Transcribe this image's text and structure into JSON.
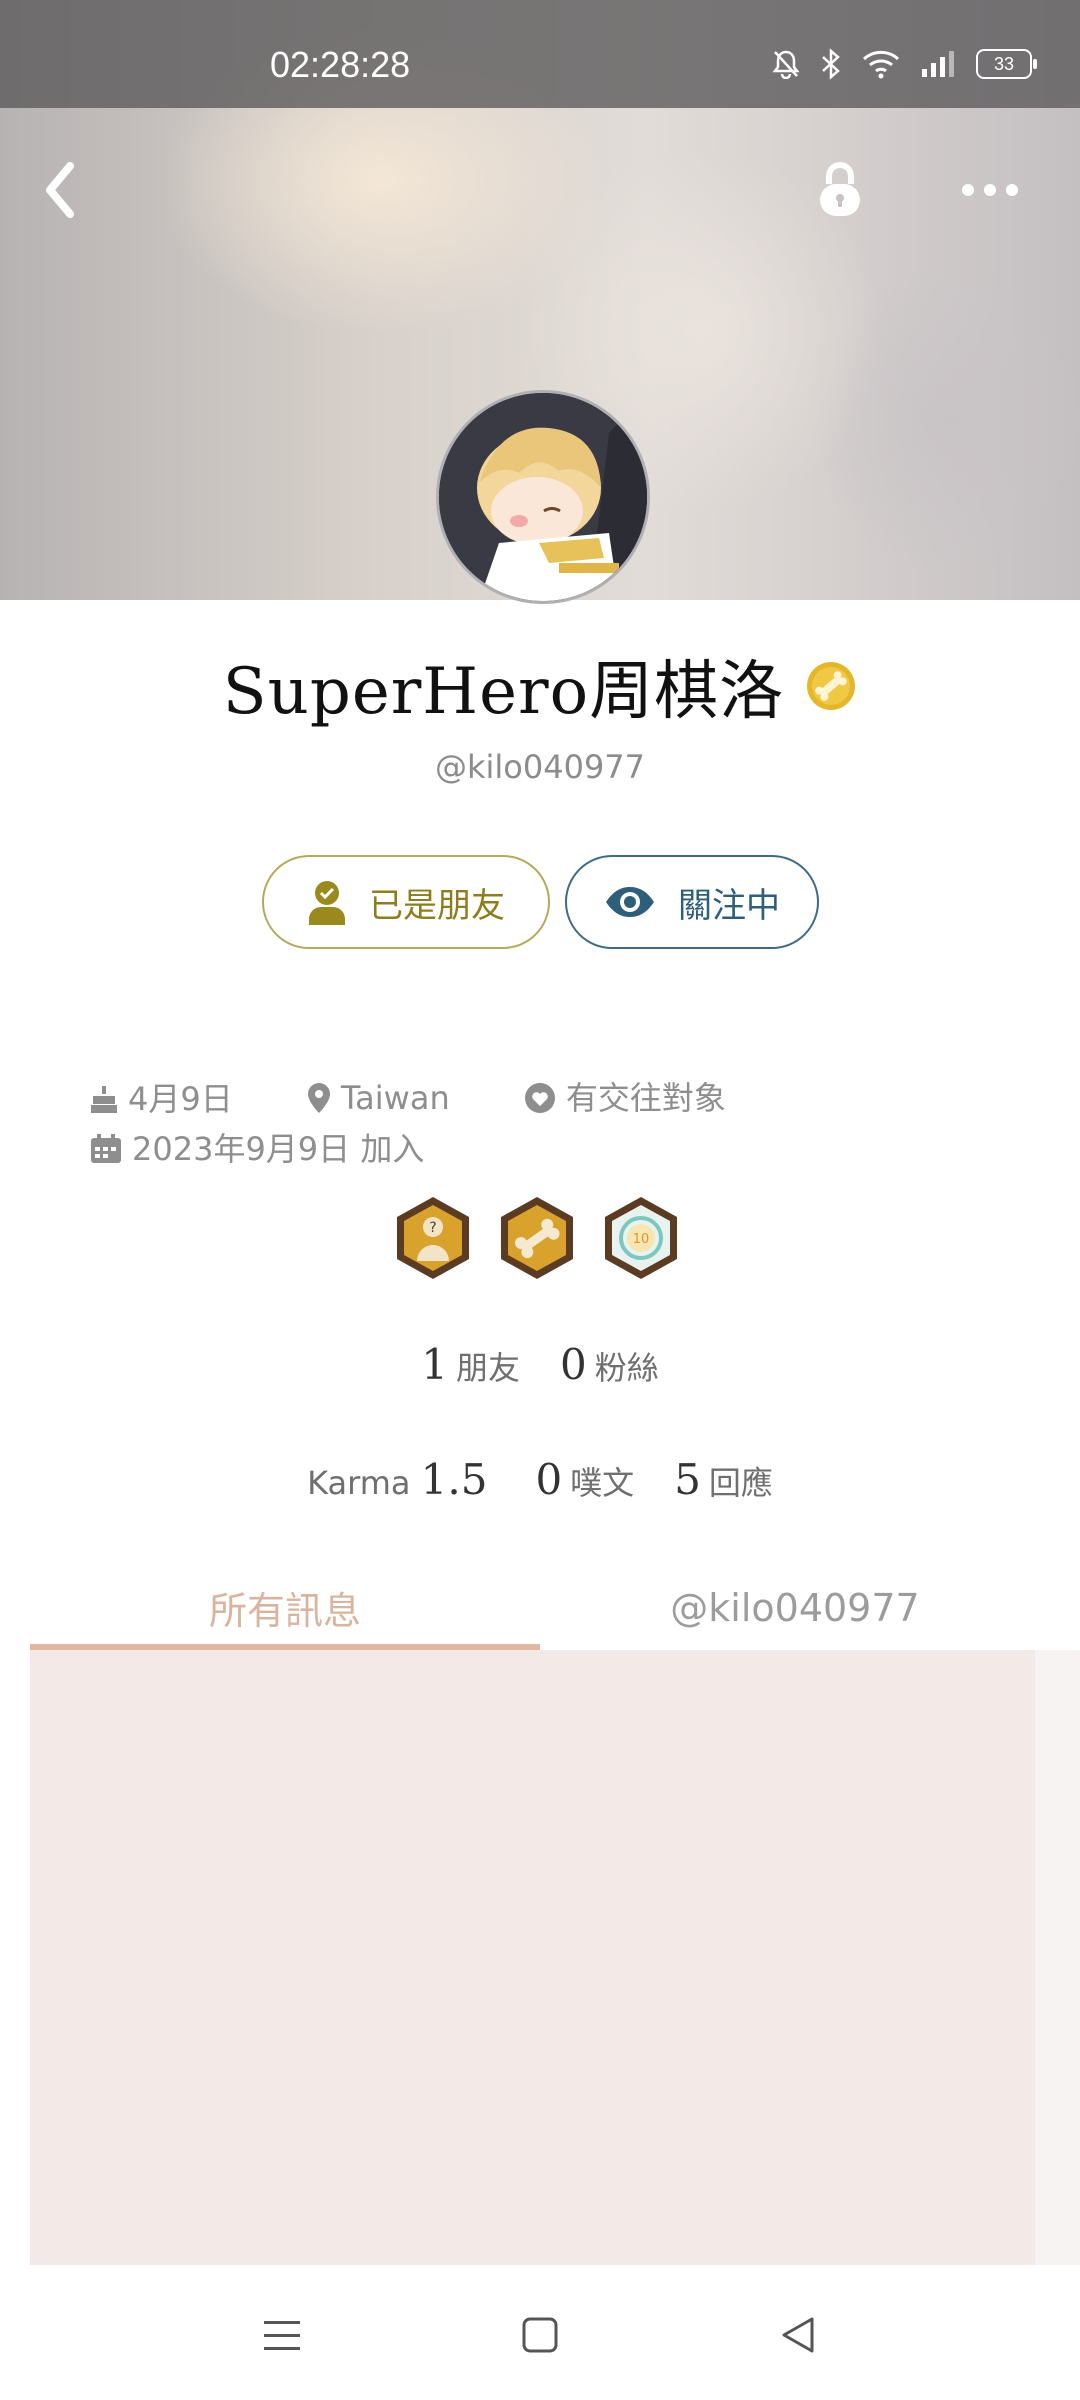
{
  "status_bar": {
    "time": "02:28:28",
    "battery": "33"
  },
  "header": {
    "back_icon": "chevron-left-icon",
    "lock_icon": "lock-icon",
    "more_icon": "more-horizontal-icon"
  },
  "profile": {
    "name": "SuperHero周棋洛",
    "handle": "@kilo040977",
    "friend_button": "已是朋友",
    "follow_button": "關注中",
    "info": {
      "birthday": "4月9日",
      "location": "Taiwan",
      "relationship": "有交往對象",
      "joined": "2023年9月9日 加入"
    },
    "stats": {
      "friends_count": "1",
      "friends_label": "朋友",
      "fans_count": "0",
      "fans_label": "粉絲",
      "karma_label": "Karma",
      "karma_value": "1.5",
      "posts_count": "0",
      "posts_label": "噗文",
      "replies_count": "5",
      "replies_label": "回應"
    }
  },
  "tabs": {
    "all": "所有訊息",
    "handle": "@kilo040977",
    "active": "all"
  },
  "colors": {
    "friend_accent": "#8d7e1b",
    "follow_accent": "#2d5f7a",
    "tab_active": "#e3b6a2",
    "content_bg": "#f3e9e7"
  }
}
